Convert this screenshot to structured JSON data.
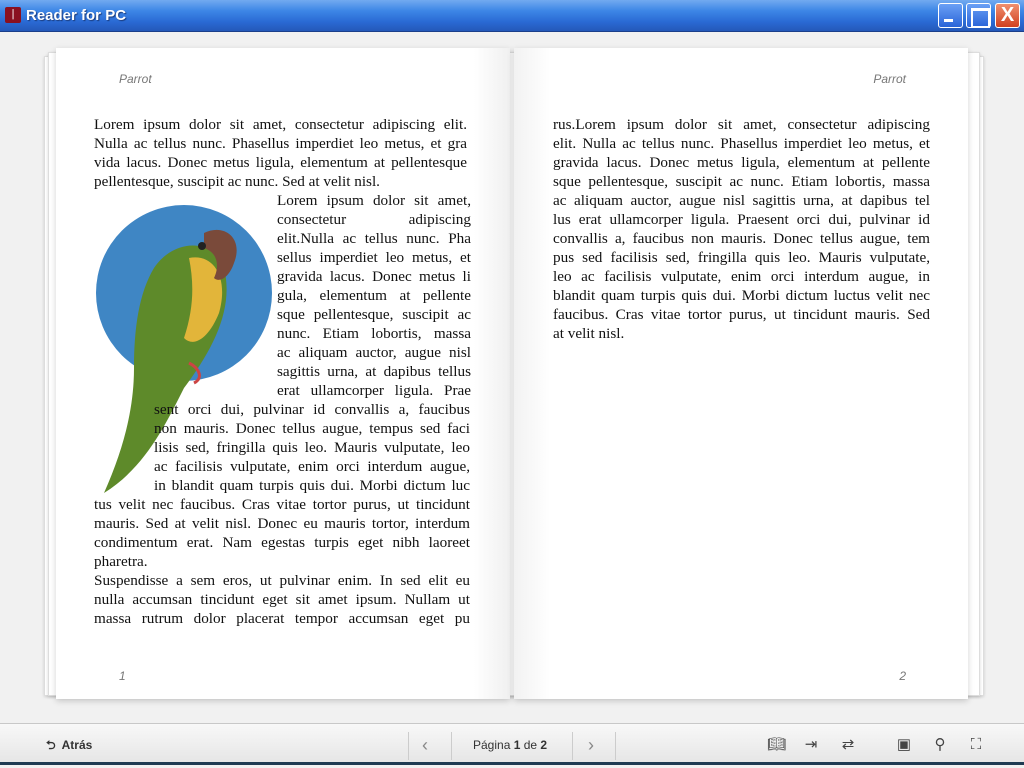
{
  "window": {
    "title": "Reader for PC",
    "app_icon": "reader-logo-icon",
    "close_glyph": "X"
  },
  "book": {
    "left": {
      "header": "Parrot",
      "page_number": "1",
      "image": "parrot-illustration",
      "lines": [
        "Lorem ipsum dolor sit amet, consectetur adipiscing elit.",
        "Nulla ac tellus nunc. Phasellus imperdiet leo metus, et gra",
        "vida lacus. Donec metus ligula, elementum at pellentesque",
        "pellentesque, suscipit ac nunc. Sed at velit nisl.",
        "Lorem ipsum dolor sit amet,",
        "consectetur adipiscing",
        "elit.Nulla ac tellus nunc. Pha",
        "sellus imperdiet leo metus, et",
        "gravida lacus. Donec metus li",
        "gula, elementum at pellente",
        "sque pellentesque, suscipit ac",
        "nunc. Etiam lobortis, massa",
        "ac aliquam auctor, augue nisl",
        "sagittis urna, at dapibus tellus",
        "erat ullamcorper ligula. Prae",
        "sent orci dui, pulvinar id convallis a, faucibus",
        "non mauris. Donec tellus augue, tempus sed faci",
        "lisis sed, fringilla quis leo. Mauris vulputate, leo",
        "ac facilisis vulputate, enim orci interdum augue,",
        "in blandit quam turpis quis dui. Morbi dictum luc",
        "tus velit nec faucibus. Cras vitae tortor purus, ut tincidunt",
        "mauris. Sed at velit nisl. Donec eu mauris tortor, interdum",
        "condimentum erat. Nam egestas turpis eget nibh laoreet",
        "pharetra.",
        "Suspendisse a sem eros, ut pulvinar enim. In sed elit eu",
        "nulla accumsan tincidunt eget sit amet ipsum. Nullam ut",
        "massa rutrum dolor placerat tempor accumsan eget pu"
      ]
    },
    "right": {
      "header": "Parrot",
      "page_number": "2",
      "lines": [
        "rus.Lorem ipsum dolor sit amet, consectetur adipiscing",
        "elit. Nulla ac tellus nunc. Phasellus imperdiet leo metus, et",
        "gravida lacus. Donec metus ligula, elementum at pellente",
        "sque pellentesque, suscipit ac nunc. Etiam lobortis, massa",
        "ac aliquam auctor, augue nisl sagittis urna, at dapibus tel",
        "lus erat ullamcorper ligula. Praesent orci dui, pulvinar id",
        "convallis a, faucibus non mauris. Donec tellus augue, tem",
        "pus sed facilisis sed, fringilla quis leo. Mauris vulputate,",
        "leo ac facilisis vulputate, enim orci interdum augue, in",
        "blandit quam turpis quis dui. Morbi dictum luctus velit nec",
        "faucibus. Cras vitae tortor purus, ut tincidunt mauris. Sed",
        "at velit nisl."
      ]
    }
  },
  "toolbar": {
    "back_label": "Atrás",
    "page_label_prefix": "Página ",
    "current_page": "1",
    "page_label_sep": " de ",
    "total_pages": "2",
    "icons": [
      "book-view-icon",
      "export-icon",
      "sync-book-icon",
      "toolbox-icon",
      "search-icon",
      "fullscreen-icon"
    ]
  }
}
